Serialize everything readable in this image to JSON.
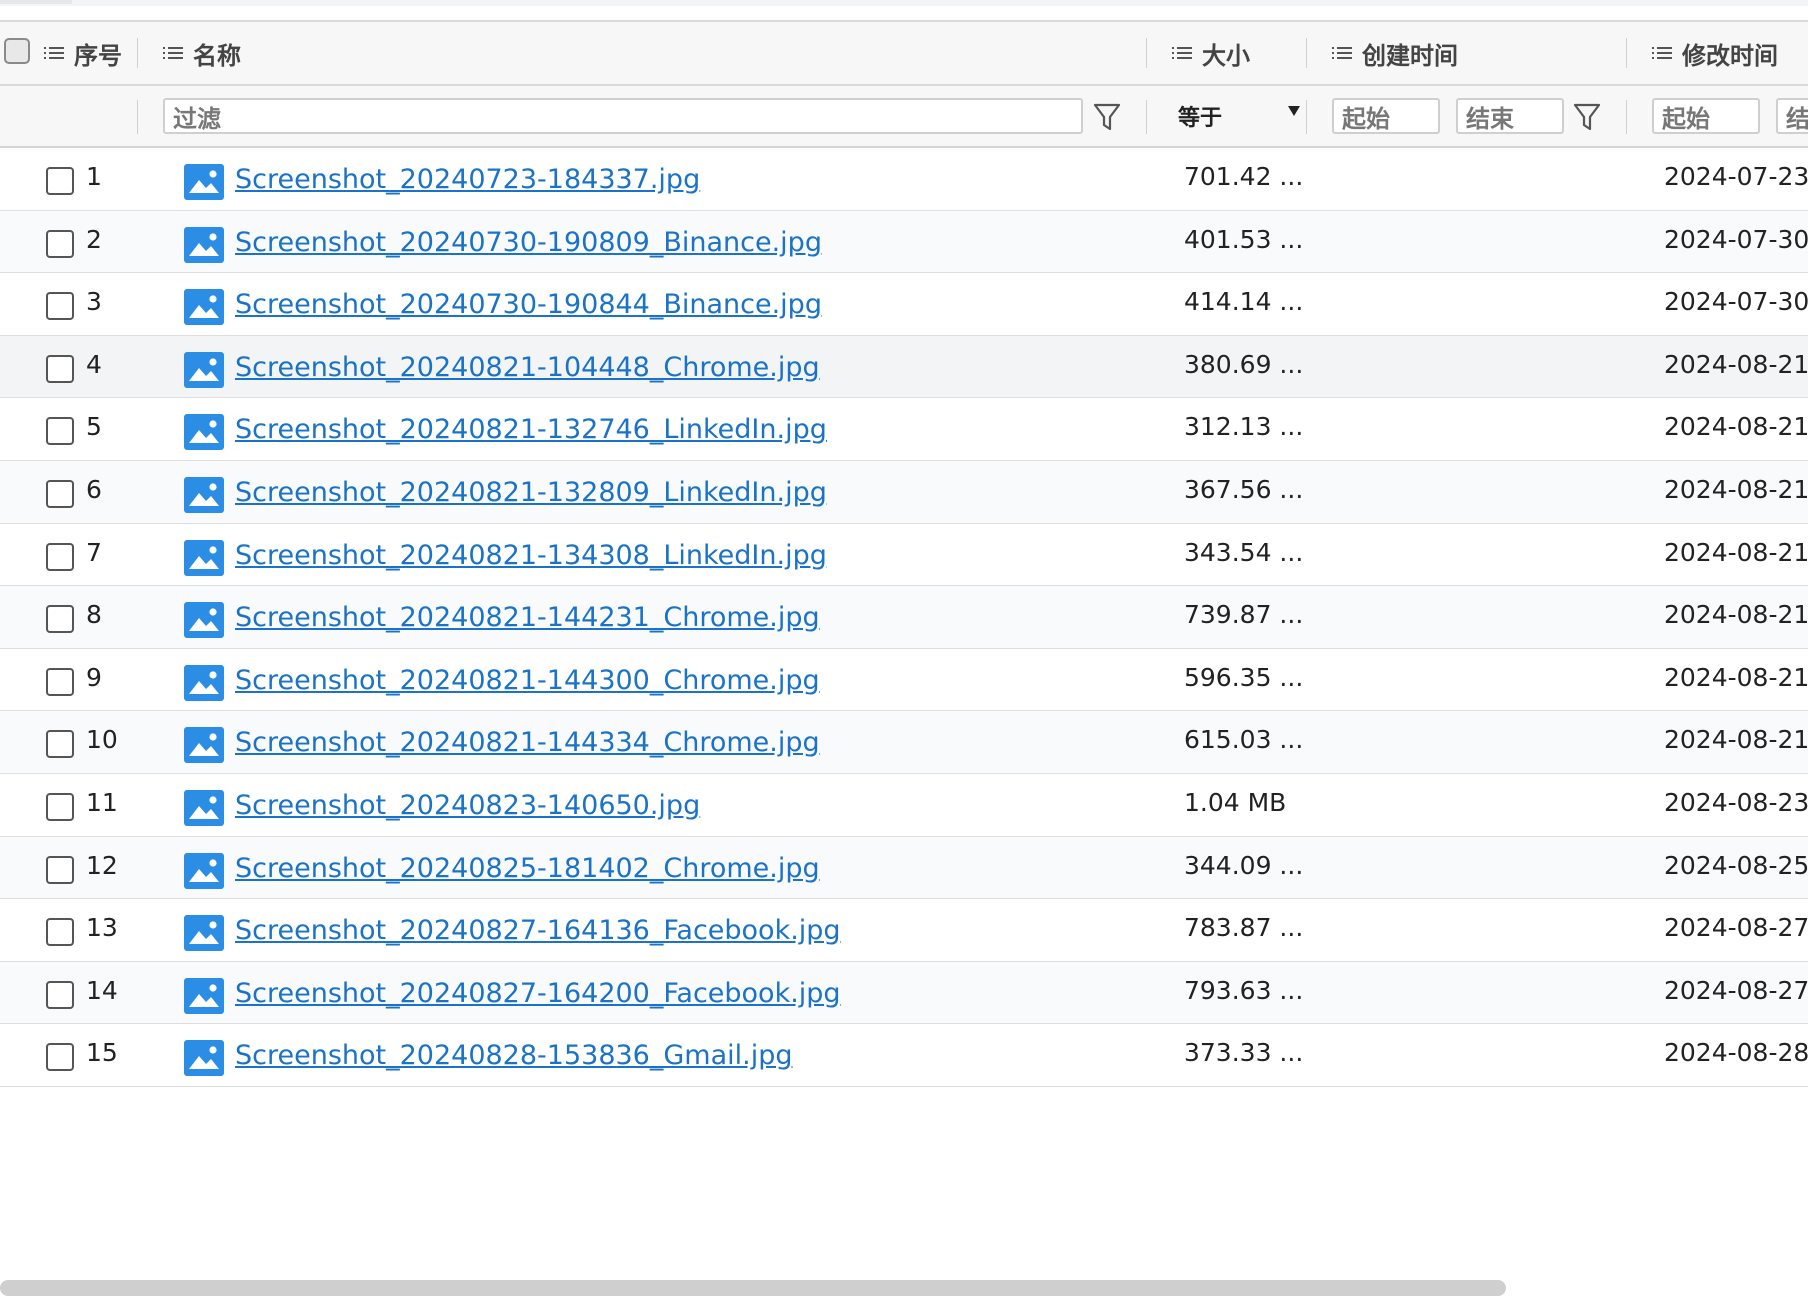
{
  "header": {
    "col_index": "序号",
    "col_name": "名称",
    "col_size": "大小",
    "col_created": "创建时间",
    "col_modified": "修改时间"
  },
  "filters": {
    "name_placeholder": "过滤",
    "size_operator": "等于",
    "created_start": "起始",
    "created_end": "结束",
    "modified_start": "起始",
    "modified_end": "结"
  },
  "colors": {
    "link": "#1a73c8",
    "file_icon": "#2b8de4"
  },
  "icons": {
    "column_menu": "list-icon",
    "filter": "funnel-icon",
    "file": "image-file-icon"
  },
  "rows": [
    {
      "index": "1",
      "name": "Screenshot_20240723-184337.jpg",
      "size": "701.42 ...",
      "modified": "2024-07-23"
    },
    {
      "index": "2",
      "name": "Screenshot_20240730-190809_Binance.jpg",
      "size": "401.53 ...",
      "modified": "2024-07-30"
    },
    {
      "index": "3",
      "name": "Screenshot_20240730-190844_Binance.jpg",
      "size": "414.14 ...",
      "modified": "2024-07-30"
    },
    {
      "index": "4",
      "name": "Screenshot_20240821-104448_Chrome.jpg",
      "size": "380.69 ...",
      "modified": "2024-08-21"
    },
    {
      "index": "5",
      "name": "Screenshot_20240821-132746_LinkedIn.jpg",
      "size": "312.13 ...",
      "modified": "2024-08-21"
    },
    {
      "index": "6",
      "name": "Screenshot_20240821-132809_LinkedIn.jpg",
      "size": "367.56 ...",
      "modified": "2024-08-21"
    },
    {
      "index": "7",
      "name": "Screenshot_20240821-134308_LinkedIn.jpg",
      "size": "343.54 ...",
      "modified": "2024-08-21"
    },
    {
      "index": "8",
      "name": "Screenshot_20240821-144231_Chrome.jpg",
      "size": "739.87 ...",
      "modified": "2024-08-21"
    },
    {
      "index": "9",
      "name": "Screenshot_20240821-144300_Chrome.jpg",
      "size": "596.35 ...",
      "modified": "2024-08-21"
    },
    {
      "index": "10",
      "name": "Screenshot_20240821-144334_Chrome.jpg",
      "size": "615.03 ...",
      "modified": "2024-08-21"
    },
    {
      "index": "11",
      "name": "Screenshot_20240823-140650.jpg",
      "size": "1.04 MB",
      "modified": "2024-08-23"
    },
    {
      "index": "12",
      "name": "Screenshot_20240825-181402_Chrome.jpg",
      "size": "344.09 ...",
      "modified": "2024-08-25"
    },
    {
      "index": "13",
      "name": "Screenshot_20240827-164136_Facebook.jpg",
      "size": "783.87 ...",
      "modified": "2024-08-27"
    },
    {
      "index": "14",
      "name": "Screenshot_20240827-164200_Facebook.jpg",
      "size": "793.63 ...",
      "modified": "2024-08-27"
    },
    {
      "index": "15",
      "name": "Screenshot_20240828-153836_Gmail.jpg",
      "size": "373.33 ...",
      "modified": "2024-08-28"
    }
  ]
}
